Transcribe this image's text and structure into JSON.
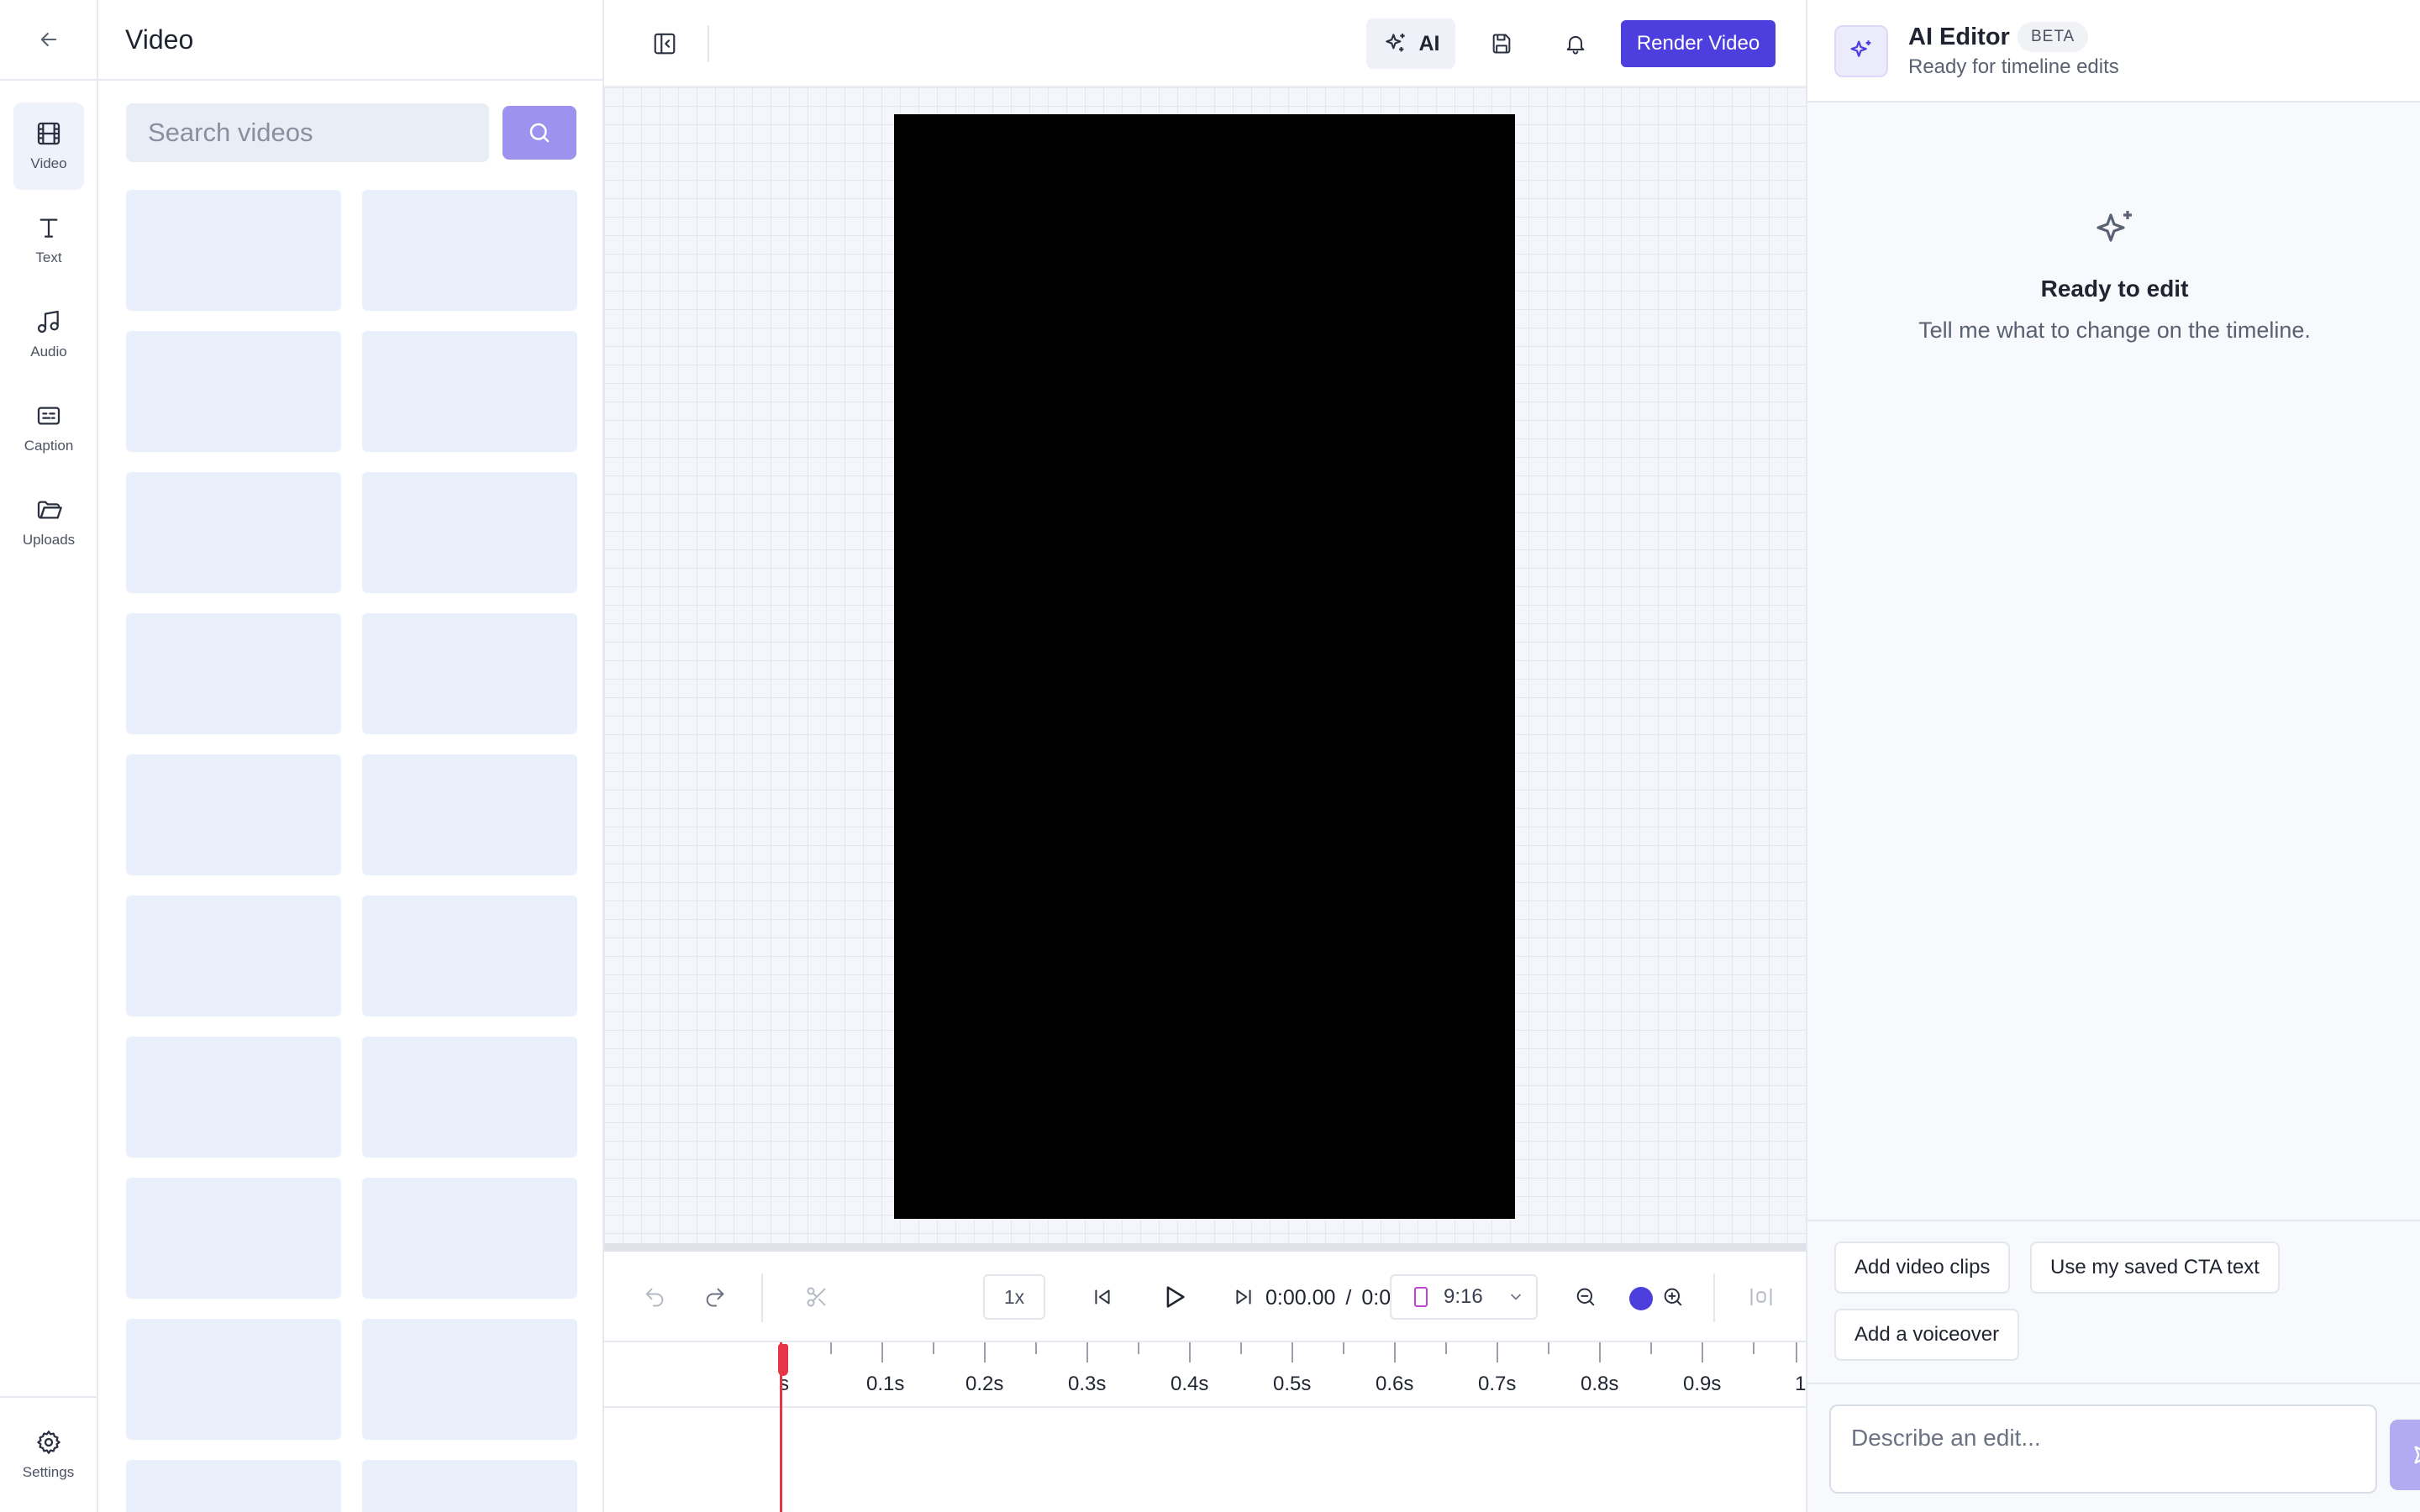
{
  "rail": {
    "items": [
      {
        "label": "Video",
        "icon": "film-icon"
      },
      {
        "label": "Text",
        "icon": "text-icon"
      },
      {
        "label": "Audio",
        "icon": "music-icon"
      },
      {
        "label": "Caption",
        "icon": "caption-icon"
      },
      {
        "label": "Uploads",
        "icon": "folder-icon"
      }
    ],
    "settings_label": "Settings",
    "active_item": "Video"
  },
  "panel": {
    "title": "Video",
    "search_placeholder": "Search videos",
    "search_value": ""
  },
  "toolbar": {
    "ai_label": "AI",
    "render_label": "Render Video"
  },
  "player": {
    "speed": "1x",
    "current_time": "0:00.00",
    "time_separator": "/",
    "total_time": "0:0",
    "aspect_ratio": "9:16"
  },
  "timeline": {
    "ticks": [
      "s",
      "0.1s",
      "0.2s",
      "0.3s",
      "0.4s",
      "0.5s",
      "0.6s",
      "0.7s",
      "0.8s",
      "0.9s",
      "1"
    ]
  },
  "ai_editor": {
    "title": "AI Editor",
    "badge": "BETA",
    "subtitle": "Ready for timeline edits",
    "empty_title": "Ready to edit",
    "empty_description": "Tell me what to change on the timeline.",
    "suggestions": [
      "Add video clips",
      "Use my saved CTA text",
      "Add a voiceover"
    ],
    "input_placeholder": "Describe an edit...",
    "input_value": ""
  },
  "colors": {
    "accent": "#4d3fde",
    "accent_light": "#9d93ef",
    "playhead": "#e53546",
    "stage": "#000000"
  }
}
